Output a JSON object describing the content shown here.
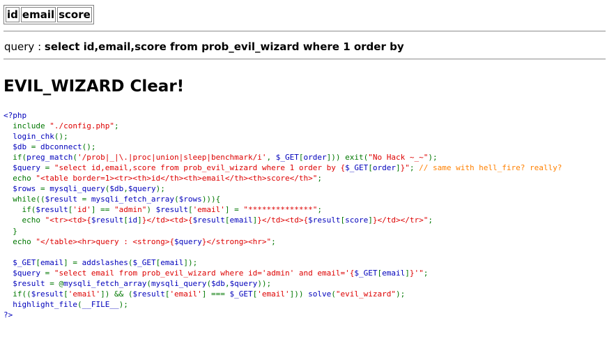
{
  "results_table": {
    "headers": [
      "id",
      "email",
      "score"
    ]
  },
  "query_line": {
    "label": "query : ",
    "value": "select id,email,score from prob_evil_wizard where 1 order by"
  },
  "heading": "EVIL_WIZARD Clear!",
  "colors": {
    "php_default": "#0000bb",
    "php_keyword": "#007700",
    "php_string": "#dd0000",
    "php_comment": "#ff8000"
  },
  "source_lines": [
    [
      [
        "default",
        "<?php"
      ]
    ],
    [
      [
        "keyword",
        "  include "
      ],
      [
        "string",
        "\"./config.php\""
      ],
      [
        "keyword",
        ";"
      ]
    ],
    [
      [
        "keyword",
        "  "
      ],
      [
        "default",
        "login_chk"
      ],
      [
        "keyword",
        "();"
      ]
    ],
    [
      [
        "keyword",
        "  "
      ],
      [
        "default",
        "$db "
      ],
      [
        "keyword",
        "= "
      ],
      [
        "default",
        "dbconnect"
      ],
      [
        "keyword",
        "();"
      ]
    ],
    [
      [
        "keyword",
        "  if("
      ],
      [
        "default",
        "preg_match"
      ],
      [
        "keyword",
        "("
      ],
      [
        "string",
        "'/prob|_|\\.|proc|union|sleep|benchmark/i'"
      ],
      [
        "keyword",
        ", "
      ],
      [
        "default",
        "$_GET"
      ],
      [
        "keyword",
        "["
      ],
      [
        "default",
        "order"
      ],
      [
        "keyword",
        "])) exit("
      ],
      [
        "string",
        "\"No Hack ~_~\""
      ],
      [
        "keyword",
        ");"
      ]
    ],
    [
      [
        "keyword",
        "  "
      ],
      [
        "default",
        "$query "
      ],
      [
        "keyword",
        "= "
      ],
      [
        "string",
        "\"select id,email,score from prob_evil_wizard where 1 order by {"
      ],
      [
        "default",
        "$_GET"
      ],
      [
        "keyword",
        "["
      ],
      [
        "default",
        "order"
      ],
      [
        "keyword",
        "]"
      ],
      [
        "string",
        "}\""
      ],
      [
        "keyword",
        "; "
      ],
      [
        "comment",
        "// same with hell_fire? really?"
      ]
    ],
    [
      [
        "keyword",
        "  echo "
      ],
      [
        "string",
        "\"<table border=1><tr><th>id</th><th>email</th><th>score</th>\""
      ],
      [
        "keyword",
        ";"
      ]
    ],
    [
      [
        "keyword",
        "  "
      ],
      [
        "default",
        "$rows "
      ],
      [
        "keyword",
        "= "
      ],
      [
        "default",
        "mysqli_query"
      ],
      [
        "keyword",
        "("
      ],
      [
        "default",
        "$db"
      ],
      [
        "keyword",
        ","
      ],
      [
        "default",
        "$query"
      ],
      [
        "keyword",
        ");"
      ]
    ],
    [
      [
        "keyword",
        "  while(("
      ],
      [
        "default",
        "$result "
      ],
      [
        "keyword",
        "= "
      ],
      [
        "default",
        "mysqli_fetch_array"
      ],
      [
        "keyword",
        "("
      ],
      [
        "default",
        "$rows"
      ],
      [
        "keyword",
        "))){"
      ]
    ],
    [
      [
        "keyword",
        "    if("
      ],
      [
        "default",
        "$result"
      ],
      [
        "keyword",
        "["
      ],
      [
        "string",
        "'id'"
      ],
      [
        "keyword",
        "] == "
      ],
      [
        "string",
        "\"admin\""
      ],
      [
        "keyword",
        ") "
      ],
      [
        "default",
        "$result"
      ],
      [
        "keyword",
        "["
      ],
      [
        "string",
        "'email'"
      ],
      [
        "keyword",
        "] = "
      ],
      [
        "string",
        "\"**************\""
      ],
      [
        "keyword",
        ";"
      ]
    ],
    [
      [
        "keyword",
        "    echo "
      ],
      [
        "string",
        "\"<tr><td>{"
      ],
      [
        "default",
        "$result"
      ],
      [
        "keyword",
        "["
      ],
      [
        "default",
        "id"
      ],
      [
        "keyword",
        "]"
      ],
      [
        "string",
        "}</td><td>{"
      ],
      [
        "default",
        "$result"
      ],
      [
        "keyword",
        "["
      ],
      [
        "default",
        "email"
      ],
      [
        "keyword",
        "]"
      ],
      [
        "string",
        "}</td><td>{"
      ],
      [
        "default",
        "$result"
      ],
      [
        "keyword",
        "["
      ],
      [
        "default",
        "score"
      ],
      [
        "keyword",
        "]"
      ],
      [
        "string",
        "}</td></tr>\""
      ],
      [
        "keyword",
        ";"
      ]
    ],
    [
      [
        "keyword",
        "  }"
      ]
    ],
    [
      [
        "keyword",
        "  echo "
      ],
      [
        "string",
        "\"</table><hr>query : <strong>{"
      ],
      [
        "default",
        "$query"
      ],
      [
        "string",
        "}</strong><hr>\""
      ],
      [
        "keyword",
        ";"
      ]
    ],
    [
      [
        "keyword",
        ""
      ]
    ],
    [
      [
        "keyword",
        "  "
      ],
      [
        "default",
        "$_GET"
      ],
      [
        "keyword",
        "["
      ],
      [
        "default",
        "email"
      ],
      [
        "keyword",
        "] = "
      ],
      [
        "default",
        "addslashes"
      ],
      [
        "keyword",
        "("
      ],
      [
        "default",
        "$_GET"
      ],
      [
        "keyword",
        "["
      ],
      [
        "default",
        "email"
      ],
      [
        "keyword",
        "]);"
      ]
    ],
    [
      [
        "keyword",
        "  "
      ],
      [
        "default",
        "$query "
      ],
      [
        "keyword",
        "= "
      ],
      [
        "string",
        "\"select email from prob_evil_wizard where id='admin' and email='{"
      ],
      [
        "default",
        "$_GET"
      ],
      [
        "keyword",
        "["
      ],
      [
        "default",
        "email"
      ],
      [
        "keyword",
        "]"
      ],
      [
        "string",
        "}'\""
      ],
      [
        "keyword",
        ";"
      ]
    ],
    [
      [
        "keyword",
        "  "
      ],
      [
        "default",
        "$result "
      ],
      [
        "keyword",
        "= @"
      ],
      [
        "default",
        "mysqli_fetch_array"
      ],
      [
        "keyword",
        "("
      ],
      [
        "default",
        "mysqli_query"
      ],
      [
        "keyword",
        "("
      ],
      [
        "default",
        "$db"
      ],
      [
        "keyword",
        ","
      ],
      [
        "default",
        "$query"
      ],
      [
        "keyword",
        "));"
      ]
    ],
    [
      [
        "keyword",
        "  if(("
      ],
      [
        "default",
        "$result"
      ],
      [
        "keyword",
        "["
      ],
      [
        "string",
        "'email'"
      ],
      [
        "keyword",
        "]) && ("
      ],
      [
        "default",
        "$result"
      ],
      [
        "keyword",
        "["
      ],
      [
        "string",
        "'email'"
      ],
      [
        "keyword",
        "] === "
      ],
      [
        "default",
        "$_GET"
      ],
      [
        "keyword",
        "["
      ],
      [
        "string",
        "'email'"
      ],
      [
        "keyword",
        "])) "
      ],
      [
        "default",
        "solve"
      ],
      [
        "keyword",
        "("
      ],
      [
        "string",
        "\"evil_wizard\""
      ],
      [
        "keyword",
        ");"
      ]
    ],
    [
      [
        "keyword",
        "  "
      ],
      [
        "default",
        "highlight_file"
      ],
      [
        "keyword",
        "("
      ],
      [
        "default",
        "__FILE__"
      ],
      [
        "keyword",
        ");"
      ]
    ],
    [
      [
        "default",
        "?>"
      ]
    ]
  ]
}
